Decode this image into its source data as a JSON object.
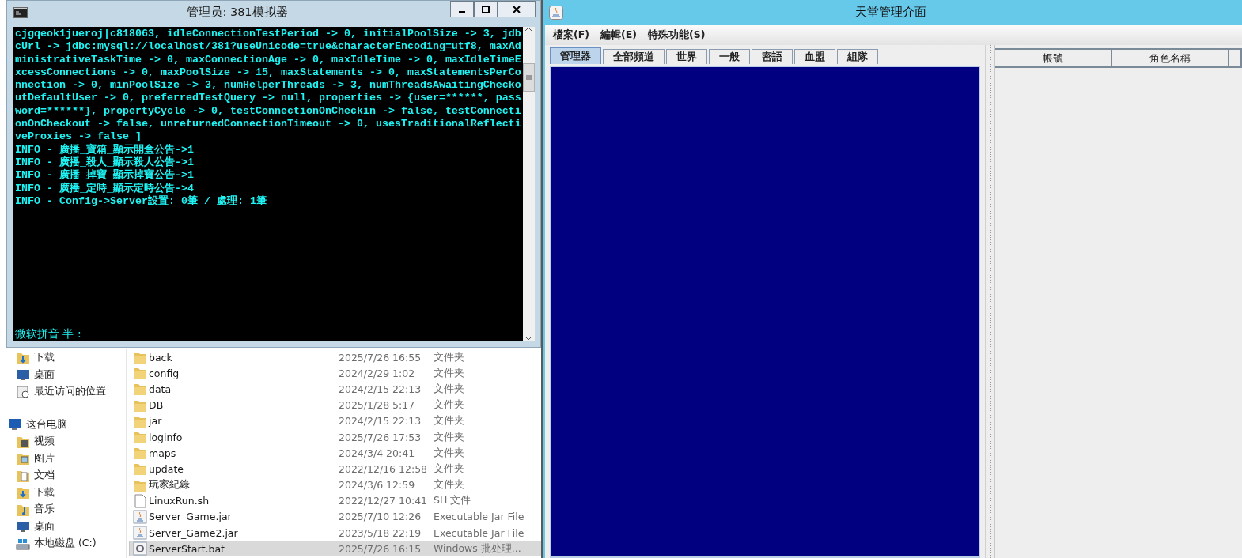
{
  "explorer": {
    "sidebar": [
      {
        "label": "下载",
        "kind": "download"
      },
      {
        "label": "桌面",
        "kind": "desktop"
      },
      {
        "label": "最近访问的位置",
        "kind": "recent"
      },
      {
        "label": "这台电脑",
        "kind": "computer"
      },
      {
        "label": "视频",
        "kind": "video"
      },
      {
        "label": "图片",
        "kind": "picture"
      },
      {
        "label": "文档",
        "kind": "document"
      },
      {
        "label": "下载",
        "kind": "download"
      },
      {
        "label": "音乐",
        "kind": "music"
      },
      {
        "label": "桌面",
        "kind": "desktop"
      },
      {
        "label": "本地磁盘 (C:)",
        "kind": "drive"
      }
    ],
    "files": [
      {
        "name": "back",
        "date": "2025/7/26 16:55",
        "type": "文件夹",
        "kind": "folder",
        "selected": false
      },
      {
        "name": "config",
        "date": "2024/2/29 1:02",
        "type": "文件夹",
        "kind": "folder",
        "selected": false
      },
      {
        "name": "data",
        "date": "2024/2/15 22:13",
        "type": "文件夹",
        "kind": "folder",
        "selected": false
      },
      {
        "name": "DB",
        "date": "2025/1/28 5:17",
        "type": "文件夹",
        "kind": "folder",
        "selected": false
      },
      {
        "name": "jar",
        "date": "2024/2/15 22:13",
        "type": "文件夹",
        "kind": "folder",
        "selected": false
      },
      {
        "name": "loginfo",
        "date": "2025/7/26 17:53",
        "type": "文件夹",
        "kind": "folder",
        "selected": false
      },
      {
        "name": "maps",
        "date": "2024/3/4 20:41",
        "type": "文件夹",
        "kind": "folder",
        "selected": false
      },
      {
        "name": "update",
        "date": "2022/12/16 12:58",
        "type": "文件夹",
        "kind": "folder",
        "selected": false
      },
      {
        "name": "玩家紀錄",
        "date": "2024/3/6 12:59",
        "type": "文件夹",
        "kind": "folder",
        "selected": false
      },
      {
        "name": "LinuxRun.sh",
        "date": "2022/12/27 10:41",
        "type": "SH 文件",
        "kind": "file",
        "selected": false
      },
      {
        "name": "Server_Game.jar",
        "date": "2025/7/10 12:26",
        "type": "Executable Jar File",
        "kind": "jar",
        "selected": false
      },
      {
        "name": "Server_Game2.jar",
        "date": "2023/5/18 22:19",
        "type": "Executable Jar File",
        "kind": "jar",
        "selected": false
      },
      {
        "name": "ServerStart.bat",
        "date": "2025/7/26 16:15",
        "type": "Windows 批处理...",
        "kind": "bat",
        "selected": true
      }
    ]
  },
  "console": {
    "title": "管理员: 381模拟器",
    "lines": [
      "cjgqeok1jueroj|c818063, idleConnectionTestPeriod -> 0, initialPoolSize -> 3, jdb",
      "cUrl -> jdbc:mysql://localhost/381?useUnicode=true&characterEncoding=utf8, maxAd",
      "ministrativeTaskTime -> 0, maxConnectionAge -> 0, maxIdleTime -> 0, maxIdleTimeE",
      "xcessConnections -> 0, maxPoolSize -> 15, maxStatements -> 0, maxStatementsPerCo",
      "nnection -> 0, minPoolSize -> 3, numHelperThreads -> 3, numThreadsAwaitingChecko",
      "utDefaultUser -> 0, preferredTestQuery -> null, properties -> {user=******, pass",
      "word=******}, propertyCycle -> 0, testConnectionOnCheckin -> false, testConnecti",
      "onOnCheckout -> false, unreturnedConnectionTimeout -> 0, usesTraditionalReflecti",
      "veProxies -> false ]",
      "INFO - 廣播_寶箱_顯示開盒公告->1",
      "INFO - 廣播_殺人_顯示殺人公告->1",
      "INFO - 廣播_掉寶_顯示掉寶公告->1",
      "INFO - 廣播_定時_顯示定時公告->4",
      "INFO - Config->Server設置: 0筆 / 處理: 1筆"
    ],
    "ime_status": "微软拼音 半 :"
  },
  "admin": {
    "title": "天堂管理介面",
    "menus": [
      "檔案(F)",
      "編輯(E)",
      "特殊功能(S)"
    ],
    "tabs": [
      {
        "label": "管理器",
        "selected": true
      },
      {
        "label": "全部頻道",
        "selected": false
      },
      {
        "label": "世界",
        "selected": false
      },
      {
        "label": "一般",
        "selected": false
      },
      {
        "label": "密語",
        "selected": false
      },
      {
        "label": "血盟",
        "selected": false
      },
      {
        "label": "組隊",
        "selected": false
      }
    ],
    "table": {
      "columns": [
        "帳號",
        "角色名稱"
      ]
    }
  }
}
